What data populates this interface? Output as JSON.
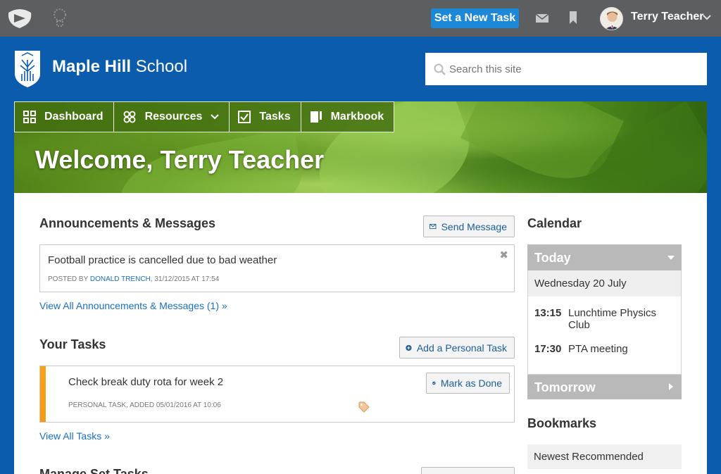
{
  "topbar": {
    "set_task_label": "Set a New Task",
    "user_name": "Terry Teacher"
  },
  "school": {
    "name_bold": "Maple Hill",
    "name_regular": " School"
  },
  "search": {
    "placeholder": "Search this site"
  },
  "nav": {
    "items": [
      {
        "label": "Dashboard",
        "icon": "grid-icon"
      },
      {
        "label": "Resources",
        "icon": "resources-icon"
      },
      {
        "label": "Tasks",
        "icon": "checkbox-icon"
      },
      {
        "label": "Markbook",
        "icon": "markbook-icon"
      }
    ]
  },
  "hero": {
    "title": "Welcome, Terry Teacher"
  },
  "announcements": {
    "heading": "Announcements & Messages",
    "send_label": "Send Message",
    "item": {
      "text": "Football practice is cancelled due to bad weather",
      "posted_by_prefix": "POSTED BY ",
      "author": "DONALD TRENCH",
      "date": ", 31/12/2015 AT 17:54"
    },
    "view_all": "View All Announcements & Messages (1) »"
  },
  "tasks": {
    "heading": "Your Tasks",
    "add_label": "Add a Personal Task",
    "item": {
      "title": "Check break duty rota for week 2",
      "meta": "PERSONAL TASK, ADDED 05/01/2016 AT 10:06",
      "done_label": "Mark as Done"
    },
    "view_all": "View All Tasks »"
  },
  "manage": {
    "heading": "Manage Set Tasks"
  },
  "calendar": {
    "heading": "Calendar",
    "today_label": "Today",
    "date": "Wednesday 20 July",
    "events": [
      {
        "time": "13:15",
        "name": "Lunchtime Physics Club"
      },
      {
        "time": "17:30",
        "name": "PTA meeting"
      }
    ],
    "tomorrow_label": "Tomorrow"
  },
  "bookmarks": {
    "heading": "Bookmarks",
    "item": "Newest Recommended"
  },
  "colors": {
    "brand_blue": "#0b5cad",
    "topbar_gray": "#5d5e60",
    "accent_button": "#1e88d8",
    "task_stripe": "#f39c12"
  }
}
